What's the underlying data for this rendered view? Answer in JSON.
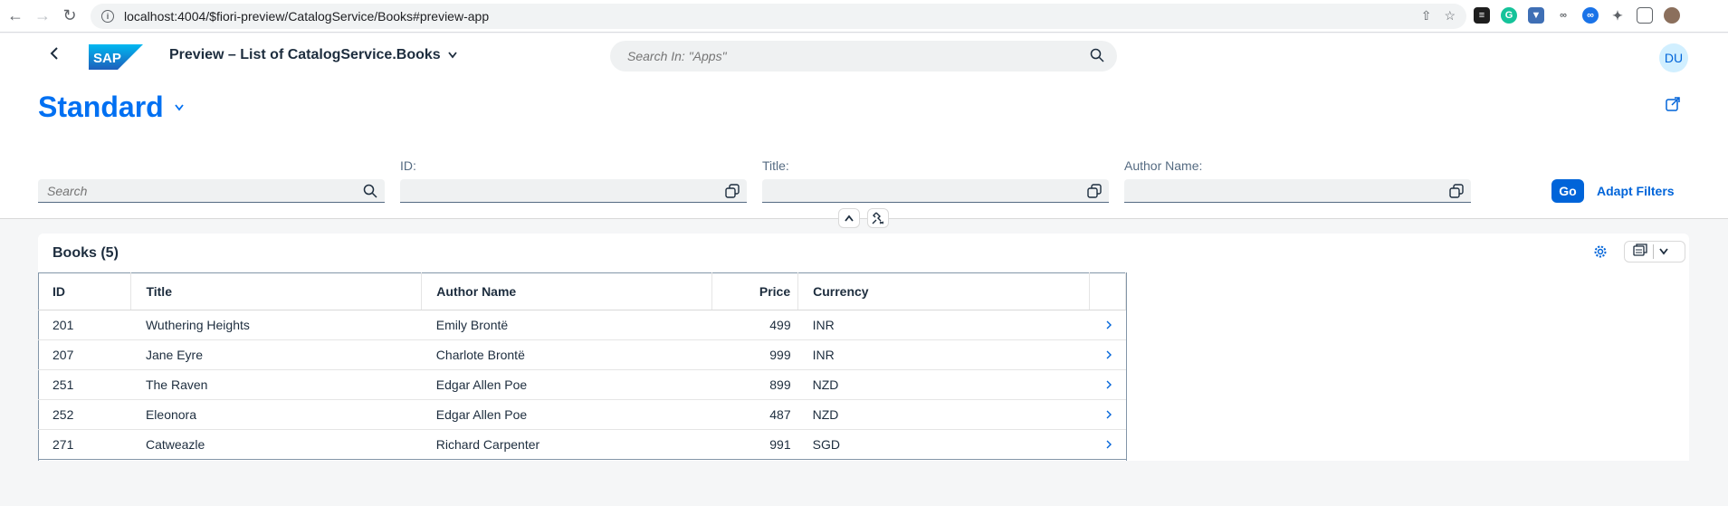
{
  "browser": {
    "url": "localhost:4004/$fiori-preview/CatalogService/Books#preview-app",
    "back_icon": "arrow-left-icon",
    "forward_icon": "arrow-right-icon",
    "reload_icon": "reload-icon"
  },
  "shell": {
    "title": "Preview – List of CatalogService.Books",
    "search_placeholder": "Search In: \"Apps\"",
    "avatar_initials": "DU",
    "logo_text": "SAP"
  },
  "header": {
    "variant": "Standard"
  },
  "filters": {
    "search_placeholder": "Search",
    "fields": [
      {
        "label": "ID:"
      },
      {
        "label": "Title:"
      },
      {
        "label": "Author Name:"
      }
    ],
    "go_label": "Go",
    "adapt_label": "Adapt Filters"
  },
  "table": {
    "title": "Books (5)",
    "columns": [
      "ID",
      "Title",
      "Author Name",
      "Price",
      "Currency"
    ],
    "rows": [
      {
        "id": "201",
        "title": "Wuthering Heights",
        "author": "Emily Brontë",
        "price": "499",
        "currency": "INR"
      },
      {
        "id": "207",
        "title": "Jane Eyre",
        "author": "Charlote Brontë",
        "price": "999",
        "currency": "INR"
      },
      {
        "id": "251",
        "title": "The Raven",
        "author": "Edgar Allen Poe",
        "price": "899",
        "currency": "NZD"
      },
      {
        "id": "252",
        "title": "Eleonora",
        "author": "Edgar Allen Poe",
        "price": "487",
        "currency": "NZD"
      },
      {
        "id": "271",
        "title": "Catweazle",
        "author": "Richard Carpenter",
        "price": "991",
        "currency": "SGD"
      }
    ]
  },
  "colors": {
    "brand_blue": "#0070f2",
    "button_blue": "#0064d9",
    "shell_bg": "#ffffff",
    "page_bg": "#f5f6f7"
  }
}
